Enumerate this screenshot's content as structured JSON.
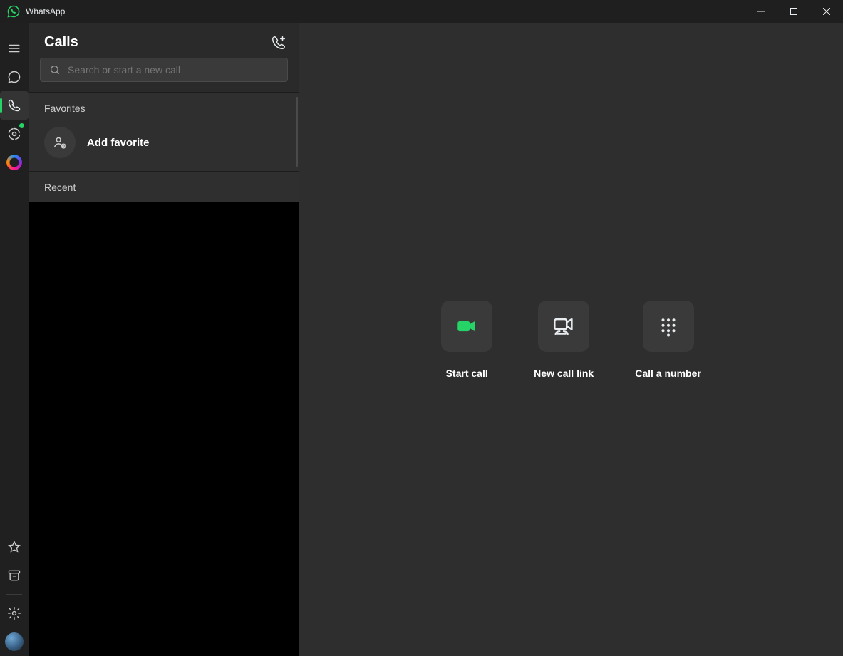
{
  "window": {
    "title": "WhatsApp"
  },
  "rail": {
    "items": [
      {
        "name": "menu"
      },
      {
        "name": "chats"
      },
      {
        "name": "calls",
        "active": true
      },
      {
        "name": "status",
        "dot": true
      },
      {
        "name": "meta-ai"
      }
    ]
  },
  "panel": {
    "title": "Calls",
    "search_placeholder": "Search or start a new call",
    "favorites_title": "Favorites",
    "add_favorite_label": "Add favorite",
    "recent_title": "Recent"
  },
  "detail": {
    "start_call_label": "Start call",
    "new_call_link_label": "New call link",
    "call_a_number_label": "Call a number"
  },
  "colors": {
    "accent": "#25d366"
  }
}
